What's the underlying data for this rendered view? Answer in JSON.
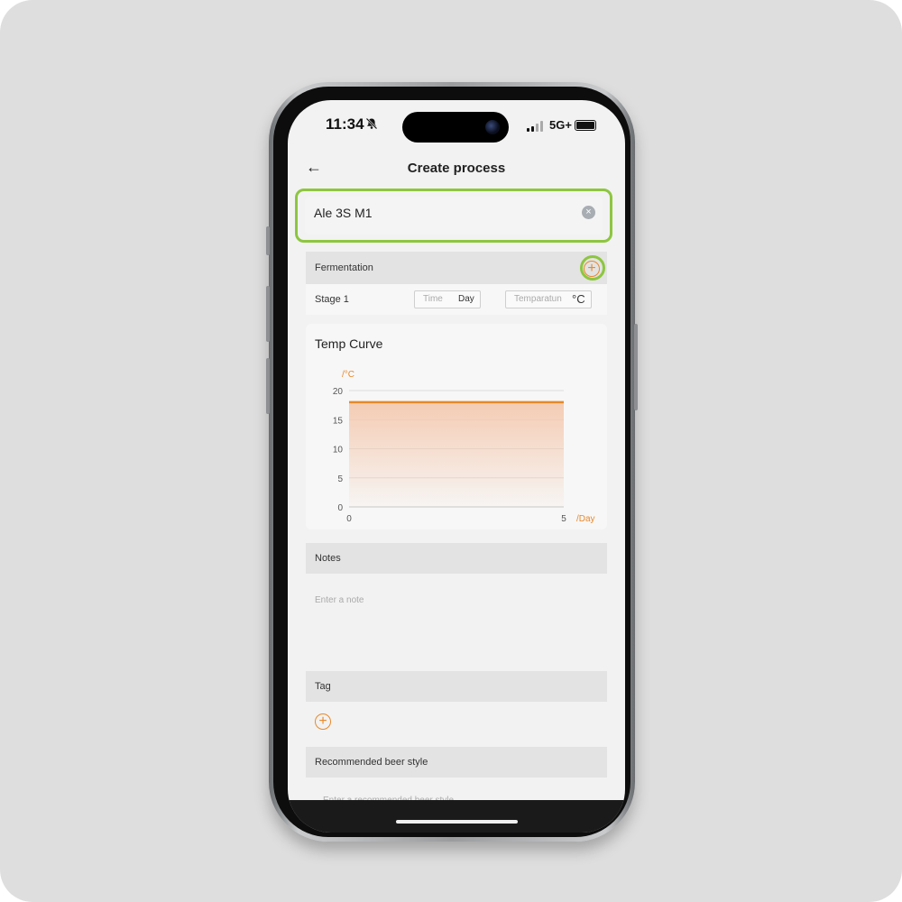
{
  "status_bar": {
    "time": "11:34",
    "network": "5G+"
  },
  "header": {
    "back_icon": "←",
    "title": "Create process"
  },
  "name_field": {
    "value": "Ale 3S M1",
    "clear_icon": "×"
  },
  "fermentation": {
    "label": "Fermentation",
    "add_icon": "+",
    "stage": {
      "label": "Stage 1",
      "time_placeholder": "Time",
      "time_unit": "Day",
      "temp_placeholder": "Temparatun",
      "temp_unit": "°C"
    }
  },
  "temp_curve": {
    "title": "Temp Curve"
  },
  "chart_data": {
    "type": "area",
    "ylabel": "/°C",
    "xlabel": "/Day",
    "x_ticks": [
      "0",
      "5"
    ],
    "y_ticks": [
      "20",
      "15",
      "10",
      "5",
      "0"
    ],
    "ylim": [
      0,
      20
    ],
    "xlim": [
      0,
      5
    ],
    "series": [
      {
        "x": [
          0,
          5
        ],
        "values": [
          18,
          18
        ]
      }
    ],
    "colors": {
      "line": "#e8892b",
      "fill": "#f4c7ac"
    }
  },
  "notes": {
    "label": "Notes",
    "placeholder": "Enter a note"
  },
  "tag": {
    "label": "Tag",
    "add_icon": "+"
  },
  "beer_style": {
    "label": "Recommended beer style",
    "placeholder": "Enter a recommended beer style"
  }
}
